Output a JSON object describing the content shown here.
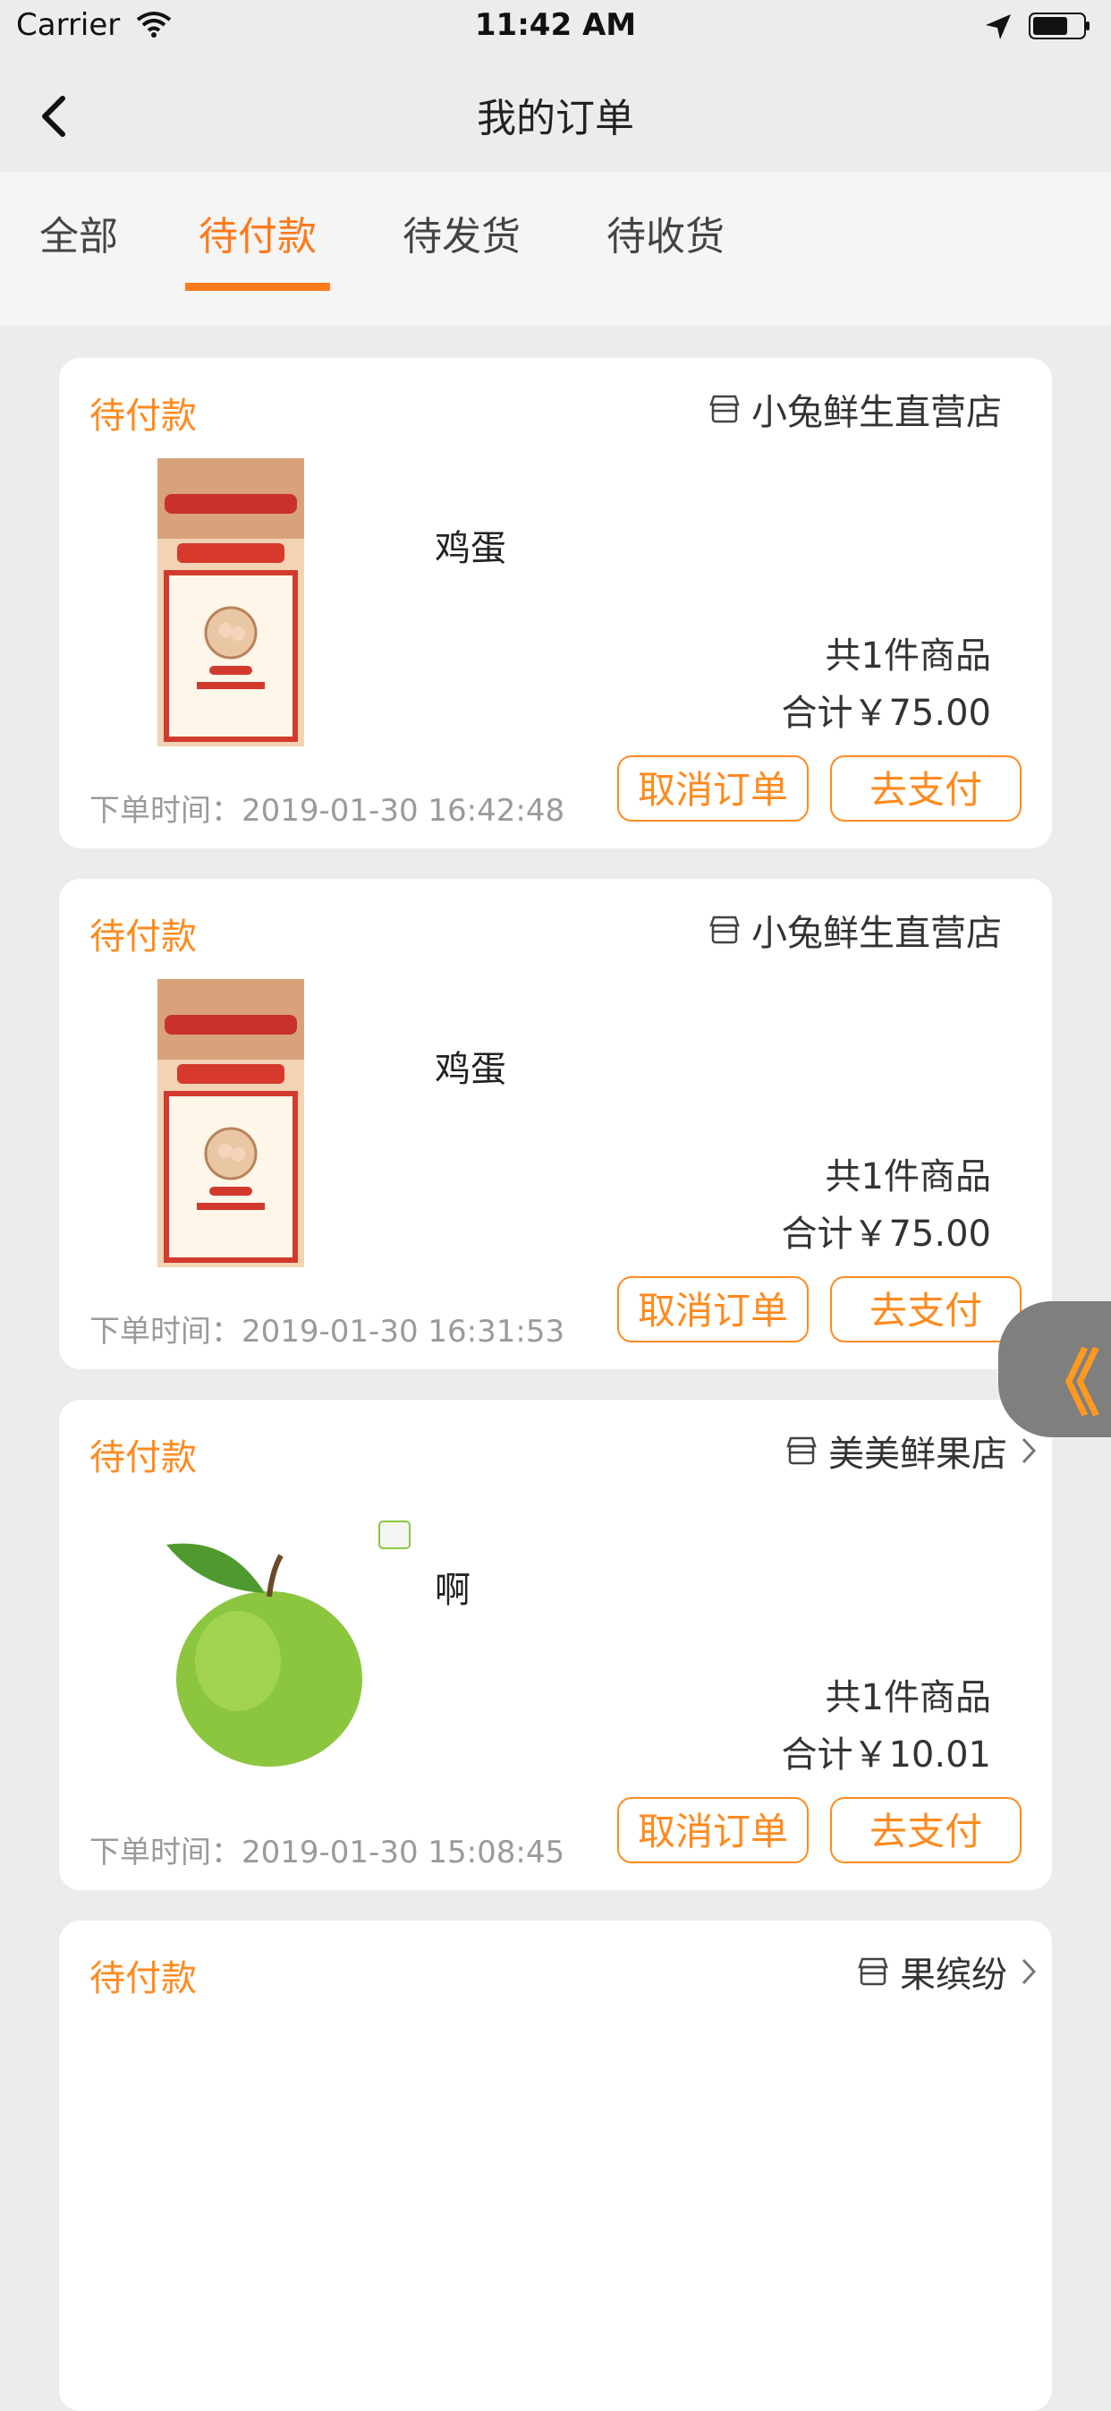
{
  "status_bar": {
    "carrier": "Carrier",
    "time": "11:42 AM"
  },
  "nav": {
    "title": "我的订单"
  },
  "tabs": [
    {
      "label": "全部",
      "active": false
    },
    {
      "label": "待付款",
      "active": true
    },
    {
      "label": "待发货",
      "active": false
    },
    {
      "label": "待收货",
      "active": false
    }
  ],
  "orders": [
    {
      "status": "待付款",
      "store": "小兔鲜生直营店",
      "product": "鸡蛋",
      "count": "共1件商品",
      "total": "合计￥75.00",
      "time": "下单时间：2019-01-30 16:42:48",
      "cancel": "取消订单",
      "pay": "去支付"
    },
    {
      "status": "待付款",
      "store": "小兔鲜生直营店",
      "product": "鸡蛋",
      "count": "共1件商品",
      "total": "合计￥75.00",
      "time": "下单时间：2019-01-30 16:31:53",
      "cancel": "取消订单",
      "pay": "去支付"
    },
    {
      "status": "待付款",
      "store": "美美鲜果店",
      "product": "啊",
      "count": "共1件商品",
      "total": "合计￥10.01",
      "time": "下单时间：2019-01-30 15:08:45",
      "cancel": "取消订单",
      "pay": "去支付"
    },
    {
      "status": "待付款",
      "store": "果缤纷"
    }
  ],
  "float_button": {
    "label": "《"
  },
  "colors": {
    "accent": "#ff7a1a",
    "background": "#ececec",
    "card": "#ffffff"
  }
}
